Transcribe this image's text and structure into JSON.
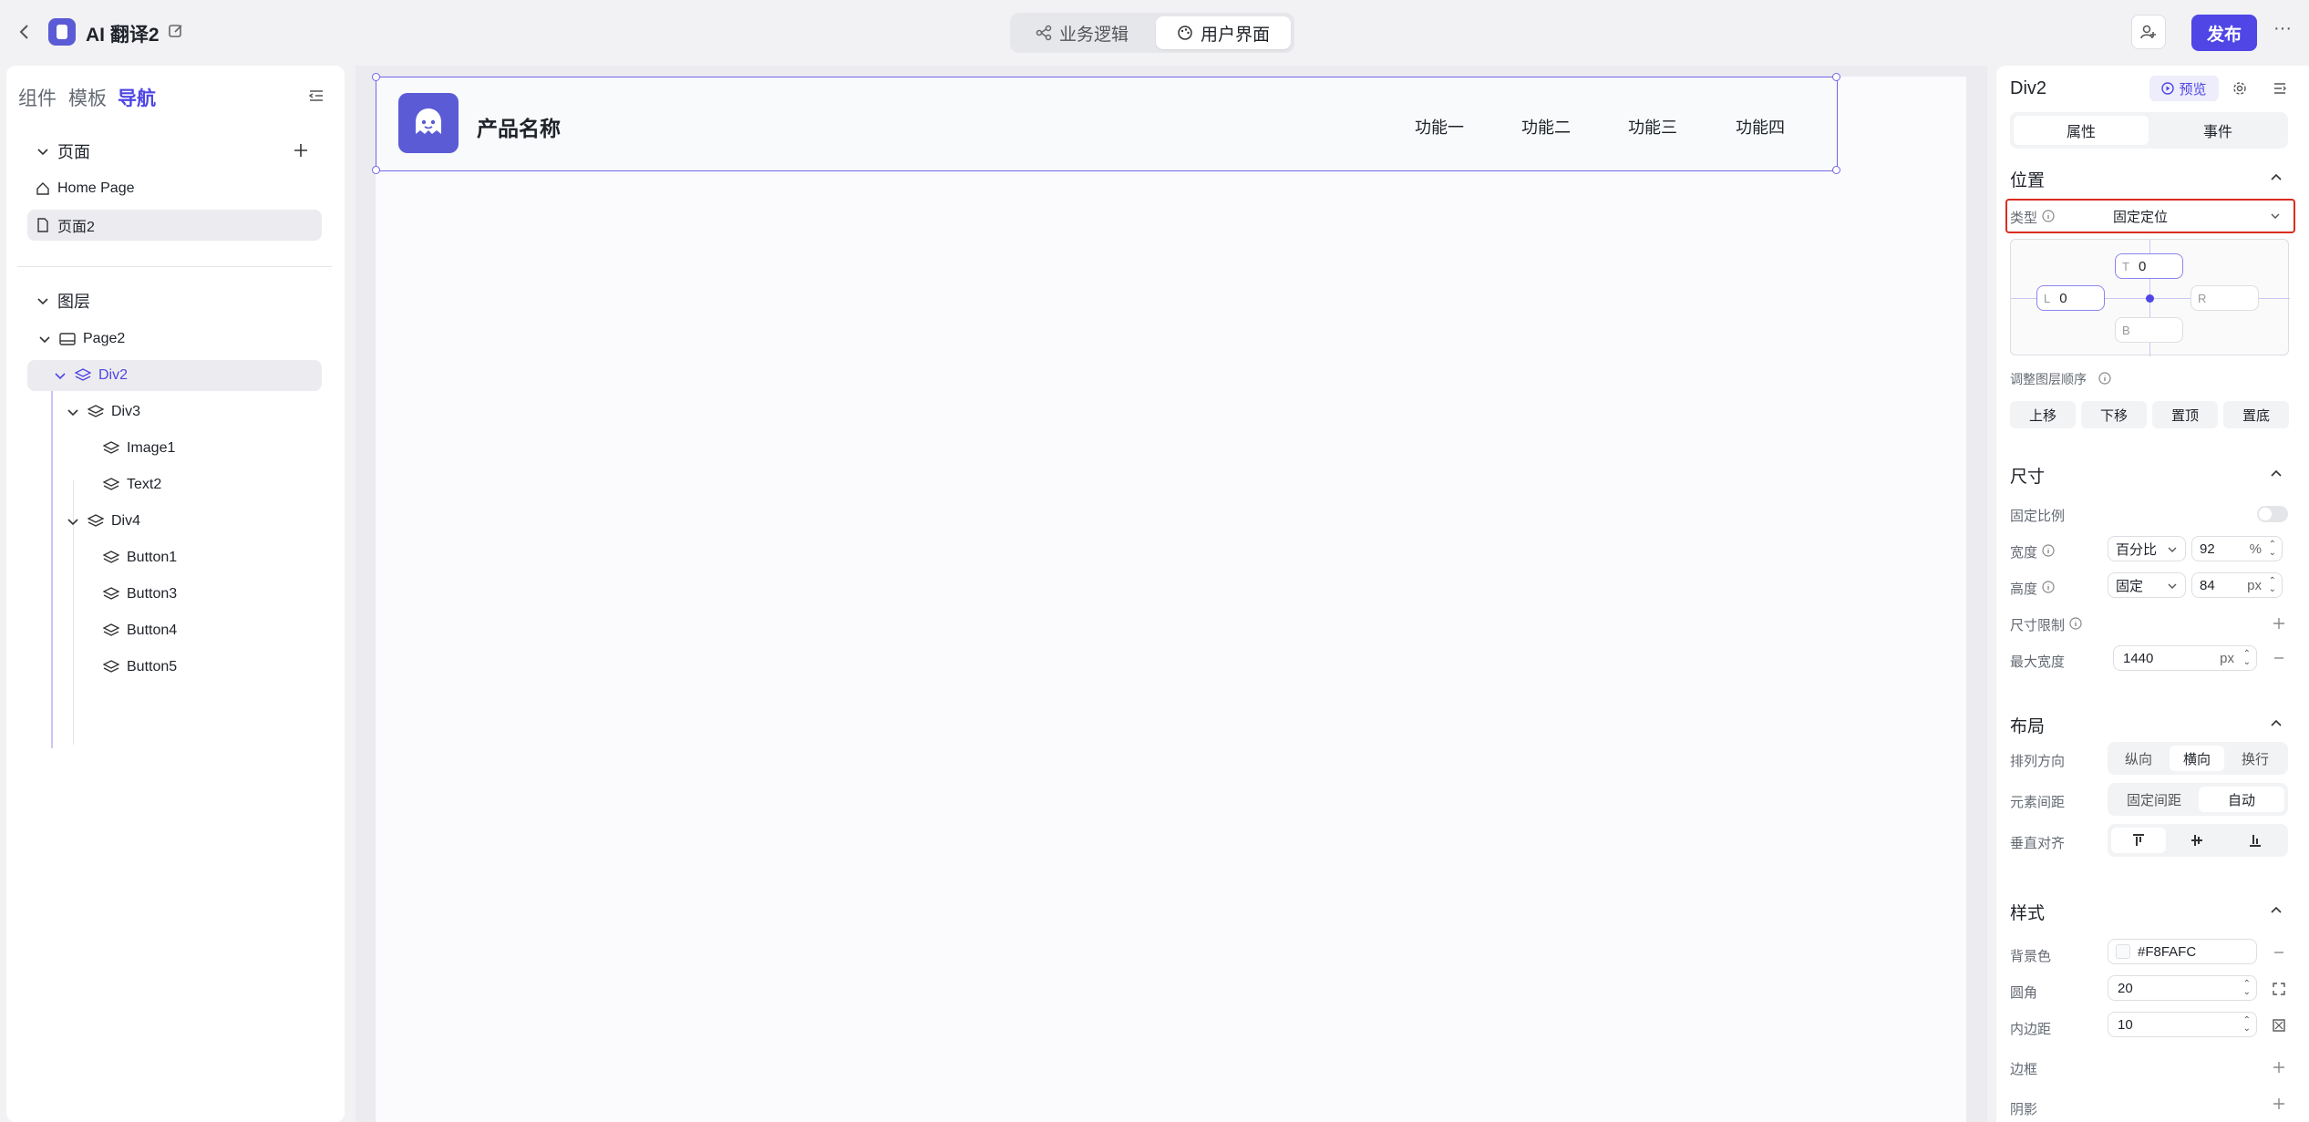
{
  "app": {
    "title": "AI 翻译2",
    "publish_label": "发布",
    "more_label": "···"
  },
  "mode_tabs": [
    {
      "label": "业务逻辑",
      "icon": "flow-icon",
      "active": false
    },
    {
      "label": "用户界面",
      "icon": "palette-icon",
      "active": true
    }
  ],
  "left_panel": {
    "tabs": [
      "组件",
      "模板",
      "导航"
    ],
    "active_tab": "导航",
    "pages_section": "页面",
    "pages": [
      "Home Page",
      "页面2"
    ],
    "layers_section": "图层",
    "layers": {
      "page": "Page2",
      "div2": "Div2",
      "div3": "Div3",
      "image1": "Image1",
      "text2": "Text2",
      "div4": "Div4",
      "button1": "Button1",
      "button3": "Button3",
      "button4": "Button4",
      "button5": "Button5"
    }
  },
  "canvas": {
    "product_name": "产品名称",
    "nav_items": [
      "功能一",
      "功能二",
      "功能三",
      "功能四"
    ]
  },
  "right_panel": {
    "title": "Div2",
    "preview_label": "预览",
    "tabs": [
      "属性",
      "事件"
    ],
    "position": {
      "section": "位置",
      "type_label": "类型",
      "type_value": "固定定位",
      "top_key": "T",
      "top_value": "0",
      "left_key": "L",
      "left_value": "0",
      "right_key": "R",
      "bottom_key": "B",
      "order_label": "调整图层顺序",
      "order_buttons": [
        "上移",
        "下移",
        "置顶",
        "置底"
      ]
    },
    "size": {
      "section": "尺寸",
      "lock_ratio_label": "固定比例",
      "width_label": "宽度",
      "width_mode": "百分比",
      "width_value": "92",
      "width_unit": "%",
      "height_label": "高度",
      "height_mode": "固定",
      "height_value": "84",
      "height_unit": "px",
      "limit_label": "尺寸限制",
      "max_width_label": "最大宽度",
      "max_width_value": "1440",
      "max_width_unit": "px"
    },
    "layout": {
      "section": "布局",
      "direction_label": "排列方向",
      "direction_options": [
        "纵向",
        "横向",
        "换行"
      ],
      "direction_active": "横向",
      "gap_label": "元素间距",
      "gap_options": [
        "固定间距",
        "自动"
      ],
      "gap_active": "自动",
      "valign_label": "垂直对齐"
    },
    "style": {
      "section": "样式",
      "bg_label": "背景色",
      "bg_value": "#F8FAFC",
      "radius_label": "圆角",
      "radius_value": "20",
      "padding_label": "内边距",
      "padding_value": "10",
      "border_label": "边框",
      "shadow_label": "阴影"
    }
  },
  "colors": {
    "accent": "#4f46e5",
    "highlight_border": "#d92d20",
    "bg": "#f2f2f5"
  }
}
